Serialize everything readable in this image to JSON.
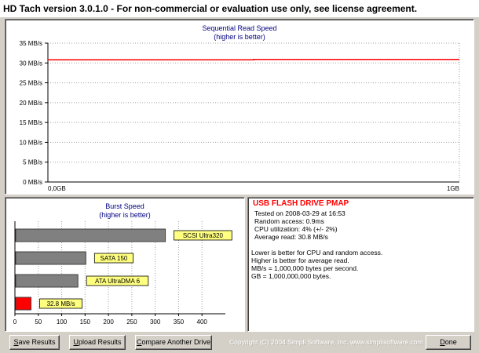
{
  "window": {
    "title": "HD Tach version 3.0.1.0  - For non-commercial or evaluation use only, see license agreement."
  },
  "sequential": {
    "title": "Sequential Read Speed",
    "subtitle": "(higher is better)",
    "y_ticks": [
      "35 MB/s",
      "30 MB/s",
      "25 MB/s",
      "20 MB/s",
      "15 MB/s",
      "10 MB/s",
      "5 MB/s",
      "0 MB/s"
    ],
    "x_start_label": "0,0GB",
    "x_end_label": "1GB"
  },
  "burst": {
    "title": "Burst Speed",
    "subtitle": "(higher is better)",
    "x_ticks": [
      "0",
      "50",
      "100",
      "150",
      "200",
      "250",
      "300",
      "350",
      "400"
    ]
  },
  "info": {
    "drive_name": "USB FLASH DRIVE PMAP",
    "tested_on": "Tested on 2008-03-29 at 16:53",
    "random_access": "Random access: 0.9ms",
    "cpu_utilization": "CPU utilization: 4% (+/- 2%)",
    "average_read": "Average read: 30.8 MB/s",
    "note1": "Lower is better for CPU and random access.",
    "note2": "Higher is better for average read.",
    "note3": "MB/s = 1,000,000 bytes per second.",
    "note4": "GB = 1,000,000,000 bytes."
  },
  "buttons": {
    "save_u": "S",
    "save_rest": "ave Results",
    "upload_u": "U",
    "upload_rest": "pload Results",
    "compare_u": "C",
    "compare_rest": "ompare Another Drive",
    "done_u": "D",
    "done_rest": "one"
  },
  "footer": {
    "copyright": "Copyright (C) 2004 Simpli Software, Inc. www.simplisoftware.com"
  },
  "colors": {
    "read_line": "#ff0000",
    "burst_bar": "#808080",
    "burst_highlight": "#ff0000",
    "label_box": "#ffff80",
    "title_red": "#ff0000",
    "chart_title_blue": "#000080"
  },
  "chart_data": [
    {
      "type": "line",
      "title": "Sequential Read Speed",
      "subtitle": "(higher is better)",
      "xlabel": "",
      "ylabel": "",
      "x_range_labels": [
        "0,0GB",
        "1GB"
      ],
      "ylim": [
        0,
        35
      ],
      "y_unit": "MB/s",
      "grid": true,
      "series": [
        {
          "x": [
            0,
            0.5,
            0.5,
            1.0
          ],
          "values": [
            30.8,
            30.8,
            30.9,
            30.9
          ]
        }
      ]
    },
    {
      "type": "bar",
      "orientation": "horizontal",
      "title": "Burst Speed",
      "subtitle": "(higher is better)",
      "xlim": [
        0,
        450
      ],
      "x_ticks": [
        0,
        50,
        100,
        150,
        200,
        250,
        300,
        350,
        400
      ],
      "categories": [
        "SCSI Ultra320",
        "SATA 150",
        "ATA UltraDMA 6",
        "32.8 MB/s"
      ],
      "values": [
        320,
        150,
        133,
        32.8
      ],
      "highlight_index": 3
    }
  ]
}
